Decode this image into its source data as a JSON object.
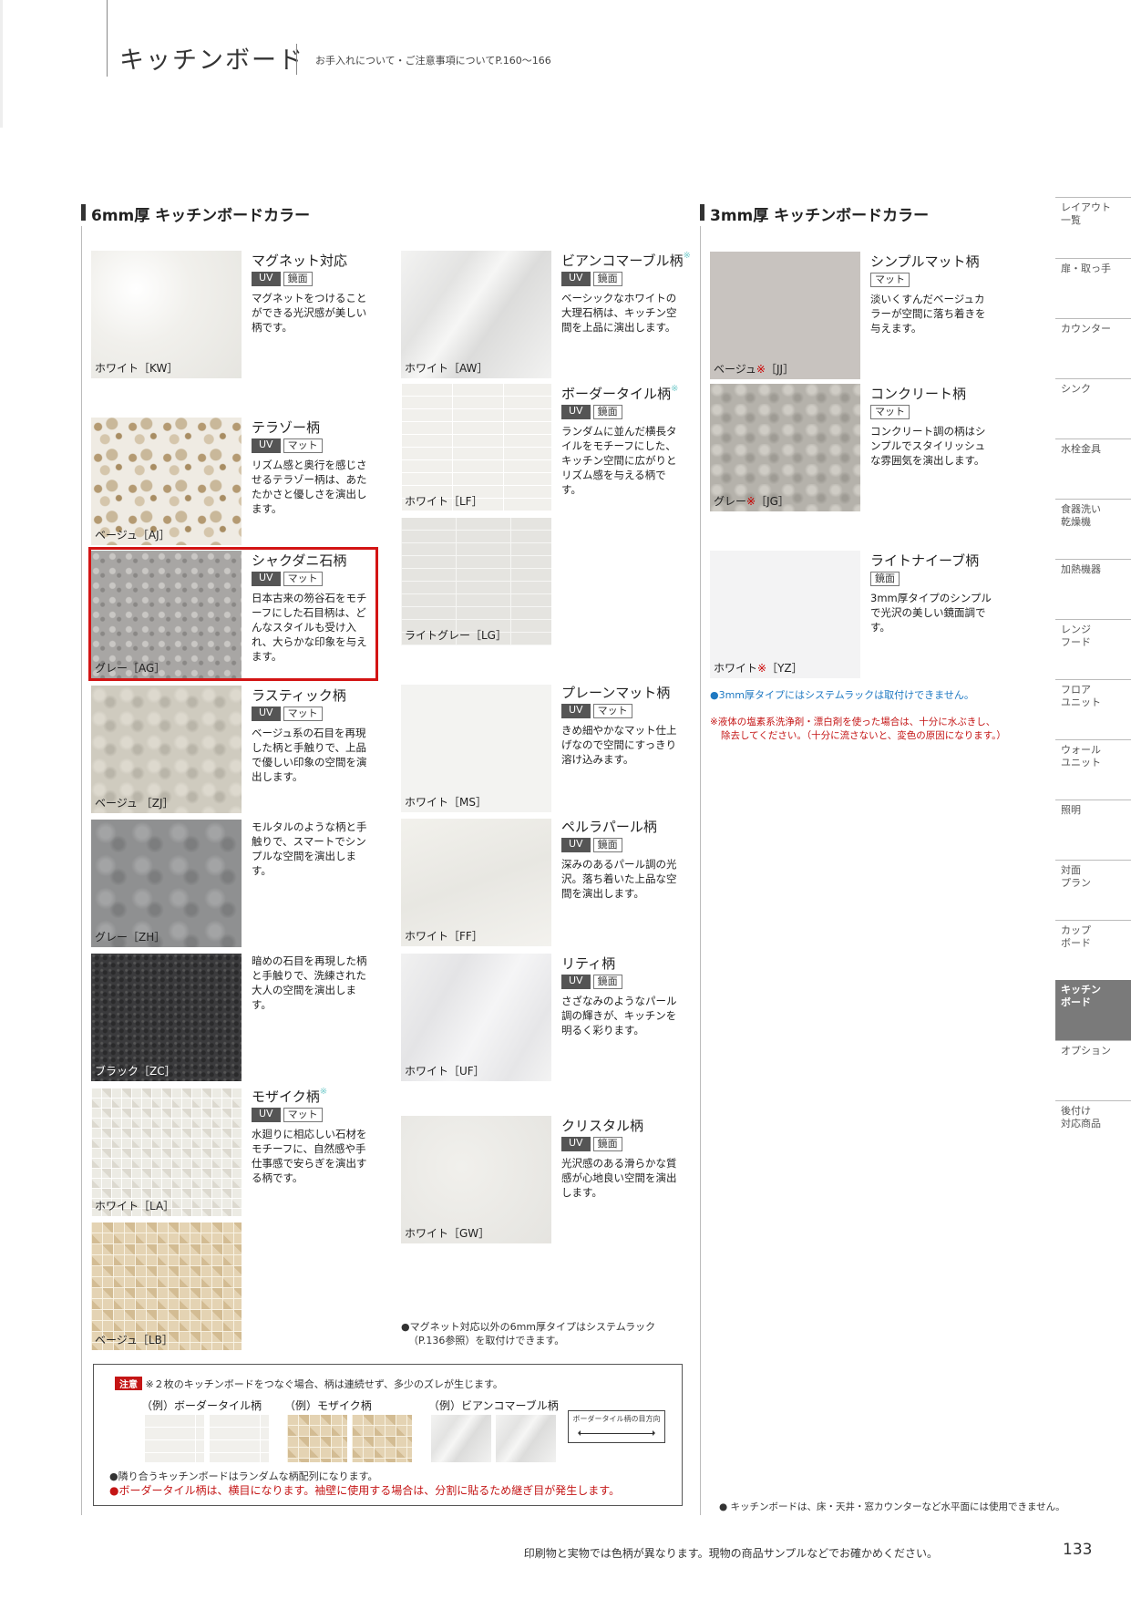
{
  "header": {
    "title": "キッチンボード",
    "note": "お手入れについて・ご注意事項についてP.160〜166"
  },
  "sections": {
    "six_mm": "6mm厚 キッチンボードカラー",
    "three_mm": "3mm厚 キッチンボードカラー"
  },
  "tags": {
    "uv": "UV",
    "mirror": "鏡面",
    "matte": "マット"
  },
  "mark": "※",
  "swatches": {
    "kw": {
      "name": "マグネット対応",
      "cap": "ホワイト［KW］",
      "desc": "マグネットをつけることができる光沢感が美しい柄です。"
    },
    "aj": {
      "name": "テラゾー柄",
      "cap": "ベージュ［AJ］",
      "desc": "リズム感と奥行を感じさせるテラゾー柄は、あたたかさと優しさを演出します。"
    },
    "ag": {
      "name": "シャクダニ石柄",
      "cap": "グレー［AG］",
      "desc": "日本古来の笏谷石をモチーフにした石目柄は、どんなスタイルも受け入れ、大らかな印象を与えます。"
    },
    "zj": {
      "name": "ラスティック柄",
      "cap": "ベージュ ［ZJ］",
      "desc": "ベージュ系の石目を再現した柄と手触りで、上品で優しい印象の空間を演出します。"
    },
    "zh": {
      "cap": "グレー［ZH］",
      "desc": "モルタルのような柄と手触りで、スマートでシンプルな空間を演出します。"
    },
    "zc": {
      "cap": "ブラック［ZC］",
      "desc": "暗めの石目を再現した柄と手触りで、洗練された大人の空間を演出します。"
    },
    "la": {
      "name": "モザイク柄",
      "cap": "ホワイト［LA］",
      "desc": "水廻りに相応しい石材をモチーフに、自然感や手仕事感で安らぎを演出する柄です。"
    },
    "lb": {
      "cap": "ベージュ［LB］"
    },
    "aw": {
      "name": "ビアンコマーブル柄",
      "cap": "ホワイト［AW］",
      "desc": "ベーシックなホワイトの大理石柄は、キッチン空間を上品に演出します。"
    },
    "lf": {
      "name": "ボーダータイル柄",
      "cap": "ホワイト［LF］",
      "desc": "ランダムに並んだ横長タイルをモチーフにした、キッチン空間に広がりとリズム感を与える柄です。"
    },
    "lg": {
      "cap": "ライトグレー［LG］"
    },
    "ms": {
      "name": "プレーンマット柄",
      "cap": "ホワイト［MS］",
      "desc": "きめ細やかなマット仕上げなので空間にすっきり溶け込みます。"
    },
    "ff": {
      "name": "ペルラパール柄",
      "cap": "ホワイト［FF］",
      "desc": "深みのあるパール調の光沢。落ち着いた上品な空間を演出します。"
    },
    "uf": {
      "name": "リティ柄",
      "cap": "ホワイト［UF］",
      "desc": "さざなみのようなパール調の輝きが、キッチンを明るく彩ります。"
    },
    "gw": {
      "name": "クリスタル柄",
      "cap": "ホワイト［GW］",
      "desc": "光沢感のある滑らかな質感が心地良い空間を演出します。"
    },
    "jj": {
      "name": "シンプルマット柄",
      "cap_a": "ベージュ",
      "cap_b": "［JJ］",
      "desc": "淡いくすんだベージュカラーが空間に落ち着きを与えます。"
    },
    "jg": {
      "name": "コンクリート柄",
      "cap_a": "グレー",
      "cap_b": "［JG］",
      "desc": "コンクリート調の柄はシンプルでスタイリッシュな雰囲気を演出します。"
    },
    "yz": {
      "name": "ライトナイーブ柄",
      "cap_a": "ホワイト",
      "cap_b": "［YZ］",
      "desc": "3mm厚タイプのシンプルで光沢の美しい鏡面調です。"
    }
  },
  "notes": {
    "rack_6mm_1": "●マグネット対応以外の6mm厚タイプはシステムラック",
    "rack_6mm_2": "（P.136参照）を取付けできます。",
    "rack_3mm": "●3mm厚タイプにはシステムラックは取付けできません。",
    "chem_1": "※液体の塩素系洗浄剤・漂白剤を使った場合は、十分に水ぶきし、",
    "chem_2": "除去してください。（十分に流さないと、変色の原因になります。）",
    "floor": "● キッチンボードは、床・天井・窓カウンターなど水平面には使用できません。"
  },
  "caution": {
    "label": "注意",
    "text": "※２枚のキッチンボードをつなぐ場合、柄は連続せず、多少のズレが生じます。",
    "ex1": "（例）ボーダータイル柄",
    "ex2": "（例）モザイク柄",
    "ex3": "（例）ビアンコマーブル柄",
    "dir": "ボーダータイル柄の目方向",
    "n1": "●隣り合うキッチンボードはランダムな柄配列になります。",
    "n2": "●ボーダータイル柄は、横目になります。袖壁に使用する場合は、分割に貼るため継ぎ目が発生します。"
  },
  "sidebar": [
    "レイアウト 一覧",
    "扉・取っ手",
    "カウンター",
    "シンク",
    "水栓金具",
    "食器洗い 乾燥機",
    "加熱機器",
    "レンジ フード",
    "フロア ユニット",
    "ウォール ユニット",
    "照明",
    "対面 プラン",
    "カップ ボード",
    "キッチン ボード",
    "オプション",
    "後付け 対応商品"
  ],
  "footer": "印刷物と実物では色柄が異なります。現物の商品サンプルなどでお確かめください。",
  "page_number": "133"
}
